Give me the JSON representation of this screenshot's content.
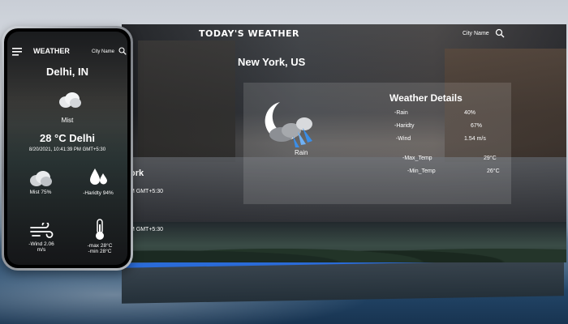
{
  "desktop": {
    "app_title": "TODAY'S WEATHER",
    "search_label": "City Name",
    "search_icon": "search-icon",
    "city": "New York, US",
    "condition": "Rain",
    "condition_icon": "moon-cloud-rain-icon",
    "details_title": "Weather Details",
    "details": [
      {
        "label": "-Rain",
        "value": "40%"
      },
      {
        "label": "-Haridty",
        "value": "67%"
      },
      {
        "label": "-Wind",
        "value": "1.54 m/s"
      },
      {
        "label": "-Max_Temp",
        "value": "29°C"
      },
      {
        "label": "-Min_Temp",
        "value": "26°C"
      }
    ],
    "partial_city": "ork",
    "partial_time": "M GMT+5:30",
    "second_screen_time": "M GMT+5:30"
  },
  "phone": {
    "app_title": "WEATHER",
    "menu_icon": "hamburger-menu-icon",
    "search_label": "City Name",
    "search_icon": "search-icon",
    "city": "Delhi, IN",
    "condition_icon": "cloud-icon",
    "condition": "Mist",
    "temperature": "28 °C Delhi",
    "datetime": "8/20/2021, 10:41:39 PM GMT+5:30",
    "stats": {
      "mist": {
        "label": "Mist 75%",
        "icon": "cloud-icon"
      },
      "humidity": {
        "label": "-Haridty 94%",
        "icon": "droplets-icon"
      },
      "wind": {
        "label1": "-Wind 2.06",
        "label2": "m/s",
        "icon": "wind-icon"
      },
      "temp": {
        "label1": "-max 28°C",
        "label2": "-min 28°C",
        "icon": "thermometer-icon"
      }
    }
  },
  "colors": {
    "accent_blue": "#2a6bd8"
  }
}
